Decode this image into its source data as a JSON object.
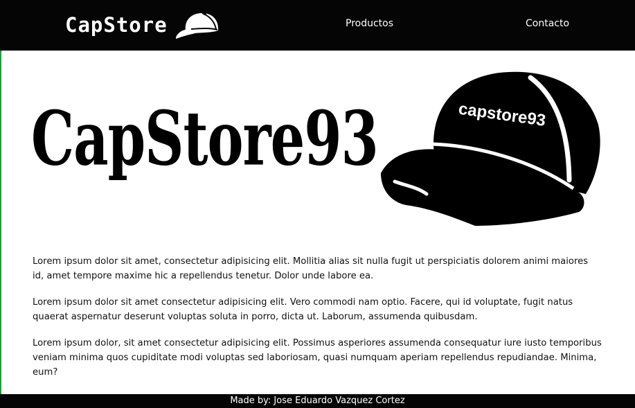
{
  "navbar": {
    "brand_text": "CapStore",
    "brand_icon": "cap-icon",
    "links": [
      {
        "label": "Productos"
      },
      {
        "label": "Contacto"
      }
    ]
  },
  "hero": {
    "title": "CapStore93",
    "cap_text": "capstore93",
    "cap_icon": "cap-icon"
  },
  "content": {
    "paragraphs": [
      "Lorem ipsum dolor sit amet, consectetur adipisicing elit. Mollitia alias sit nulla fugit ut perspiciatis dolorem animi maiores id, amet tempore maxime hic a repellendus tenetur. Dolor unde labore ea.",
      "Lorem ipsum dolor sit amet consectetur adipisicing elit. Vero commodi nam optio. Facere, qui id voluptate, fugit natus quaerat aspernatur deserunt voluptas soluta in porro, dicta ut. Laborum, assumenda quibusdam.",
      "Lorem ipsum dolor, sit amet consectetur adipisicing elit. Possimus asperiores assumenda consequatur iure iusto temporibus veniam minima quos cupiditate modi voluptas sed laboriosam, quasi numquam aperiam repellendus repudiandae. Minima, eum?"
    ]
  },
  "footer": {
    "text": "Made by: Jose Eduardo Vazquez Cortez"
  },
  "colors": {
    "navbar_bg": "#050505",
    "page_bg": "#ffffff",
    "text": "#111111",
    "left_edge": "#1e9e3a"
  }
}
